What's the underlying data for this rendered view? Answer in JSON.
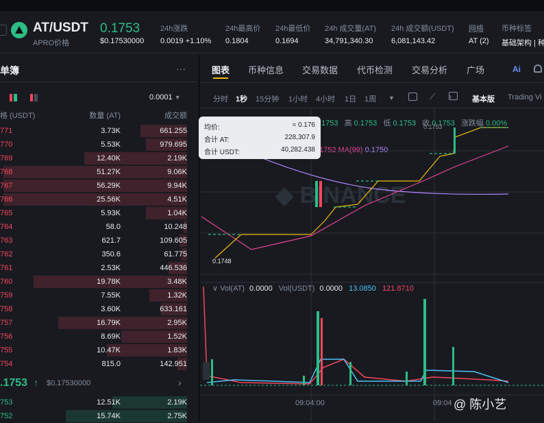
{
  "header": {
    "pair": "AT/USDT",
    "subtitle": "APRO价格",
    "last_price": "0.1753",
    "last_price_usd": "$0.17530000",
    "stats": [
      {
        "label": "24h涨跌",
        "value": "0.0019 +1.10%"
      },
      {
        "label": "24h最高价",
        "value": "0.1804"
      },
      {
        "label": "24h最低价",
        "value": "0.1694"
      },
      {
        "label": "24h 成交量(AT)",
        "value": "34,791,340.30"
      },
      {
        "label": "24h 成交额(USDT)",
        "value": "6,081,143.42"
      },
      {
        "label": "网络",
        "value": "AT (2)"
      },
      {
        "label": "币种标签",
        "value": "基础架构 | 种"
      }
    ]
  },
  "orderbook": {
    "title": "单簿",
    "more": "···",
    "precision": "0.0001",
    "columns": [
      "格 (USDT)",
      "数量 (AT)",
      "成交额"
    ],
    "asks": [
      {
        "price": "771",
        "qty": "3.73K",
        "total": "661.255",
        "depth": 0.25
      },
      {
        "price": "770",
        "qty": "5.53K",
        "total": "979.695",
        "depth": 0.22
      },
      {
        "price": "769",
        "qty": "12.40K",
        "total": "2.19K",
        "depth": 0.55
      },
      {
        "price": "768",
        "qty": "51.27K",
        "total": "9.06K",
        "depth": 0.98
      },
      {
        "price": "767",
        "qty": "56.29K",
        "total": "9.94K",
        "depth": 0.98
      },
      {
        "price": "766",
        "qty": "25.56K",
        "total": "4.51K",
        "depth": 0.98
      },
      {
        "price": "765",
        "qty": "5.93K",
        "total": "1.04K",
        "depth": 0.22
      },
      {
        "price": "764",
        "qty": "58.0",
        "total": "10.248",
        "depth": 0.02
      },
      {
        "price": "763",
        "qty": "621.7",
        "total": "109.605",
        "depth": 0.04
      },
      {
        "price": "762",
        "qty": "350.6",
        "total": "61.775",
        "depth": 0.03
      },
      {
        "price": "761",
        "qty": "2.53K",
        "total": "446.536",
        "depth": 0.1
      },
      {
        "price": "760",
        "qty": "19.78K",
        "total": "3.48K",
        "depth": 0.82
      },
      {
        "price": "759",
        "qty": "7.55K",
        "total": "1.32K",
        "depth": 0.2
      },
      {
        "price": "758",
        "qty": "3.60K",
        "total": "633.161",
        "depth": 0.14
      },
      {
        "price": "757",
        "qty": "16.79K",
        "total": "2.95K",
        "depth": 0.69
      },
      {
        "price": "756",
        "qty": "8.69K",
        "total": "1.52K",
        "depth": 0.35
      },
      {
        "price": "755",
        "qty": "10.47K",
        "total": "1.83K",
        "depth": 0.43
      },
      {
        "price": "754",
        "qty": "815.0",
        "total": "142.951",
        "depth": 0.05
      }
    ],
    "mid_price": ".1753",
    "mid_arrow": "↑",
    "mid_usd": "$0.17530000",
    "bids": [
      {
        "price": "753",
        "qty": "12.51K",
        "total": "2.19K",
        "depth": 0.4
      },
      {
        "price": "752",
        "qty": "15.74K",
        "total": "2.75K",
        "depth": 0.65
      }
    ]
  },
  "chart_tabs": [
    "图表",
    "币种信息",
    "交易数据",
    "代币检测",
    "交易分析",
    "广场"
  ],
  "intervals": [
    "分时",
    "1秒",
    "15分钟",
    "1小时",
    "4小时",
    "1日",
    "1周"
  ],
  "view_mode": "基本版",
  "view_mode_alt": "Trading Vi",
  "ohlc": {
    "o": ".1753",
    "h_label": "高",
    "h": "0.1753",
    "l_label": "低",
    "l": "0.1753",
    "c_label": "收",
    "c": "0.1753",
    "chg_label": "涨跌幅",
    "chg": "0.00%",
    "ma_row": "1752  MA(99)",
    "ma99": "0.1750"
  },
  "tooltip": {
    "avg_label": "均价:",
    "avg": "≈ 0.176",
    "sum_at_label": "合计 AT:",
    "sum_at": "228,307.9",
    "sum_usdt_label": "合计 USDT:",
    "sum_usdt": "40,282.438"
  },
  "price_labels": {
    "low": "0.1748",
    "high": "0.1753"
  },
  "volume": {
    "label": "Vol(AT)",
    "vol_at": "0.0000",
    "label2": "Vol(USDT)",
    "vol_usdt": "0.0000",
    "v1": "13.0850",
    "v2": "121.8710"
  },
  "time_labels": [
    "09:04:00",
    "09:04"
  ],
  "watermark": "@ 陈小艺",
  "colors": {
    "up": "#2ebd85",
    "down": "#f6465d",
    "accent": "#f0b90b"
  }
}
